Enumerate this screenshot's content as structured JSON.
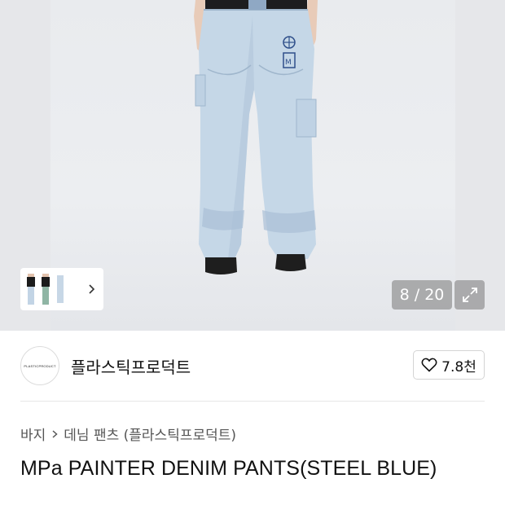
{
  "gallery": {
    "counter": "8 / 20",
    "thumbnails": [
      "thumbnail-1",
      "thumbnail-2",
      "thumbnail-3"
    ]
  },
  "brand": {
    "logo_text": "PLASTICPRODUCT",
    "name": "플라스틱프로덕트",
    "likes": "7.8천"
  },
  "breadcrumb": {
    "level1": "바지",
    "level2": "데님 팬츠 (플라스틱프로덕트)"
  },
  "product": {
    "title": "MPa PAINTER DENIM PANTS(STEEL BLUE)"
  },
  "colors": {
    "denim": "#c4d6e6",
    "denim_shadow": "#a9c0d6",
    "overlay": "#7a7a7a"
  },
  "icons": [
    "chevron-right-icon",
    "expand-icon",
    "heart-icon"
  ]
}
